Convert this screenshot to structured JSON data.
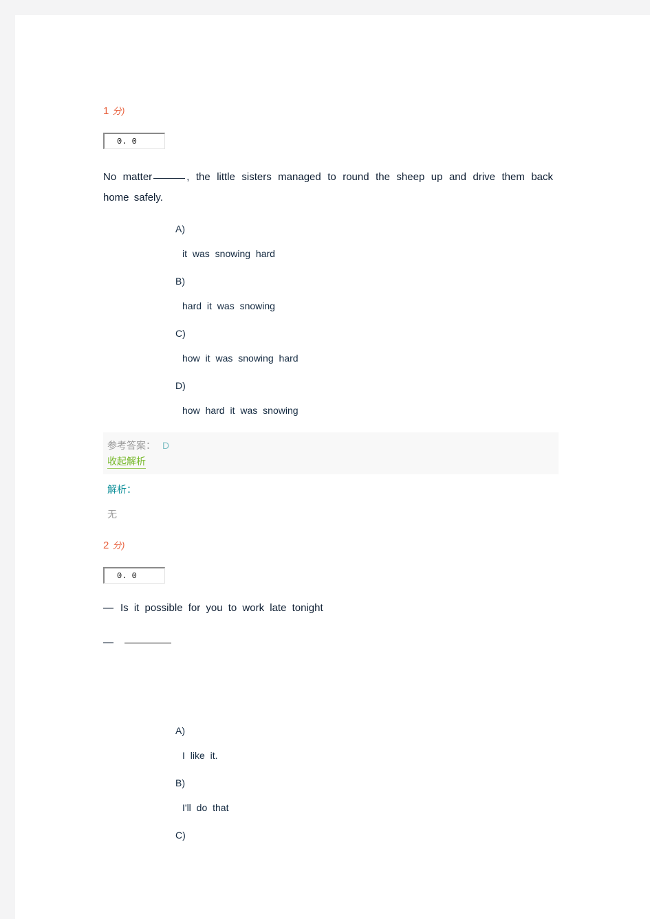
{
  "page": {
    "background": "#f4f4f5",
    "sheet_background": "#ffffff"
  },
  "colors": {
    "score_header": "#e8603c",
    "body_text": "#0f1f33",
    "answer_label": "#9b9b9b",
    "answer_value": "#7fbfc4",
    "toggle_link": "#76b82a",
    "analysis_label": "#0d8f99",
    "answer_band_bg": "#f8f8f8"
  },
  "questions": [
    {
      "score_number": "1",
      "score_unit": "分)",
      "score_input_value": "0. 0",
      "score_input_placeholder": "0. 0",
      "stem_before_blank": "No  matter",
      "stem_after_blank": ", the  little  sisters  managed  to  round  the  sheep  up  and  drive  them  back  home  safely.",
      "options": [
        {
          "letter": "A)",
          "text": "it  was  snowing  hard"
        },
        {
          "letter": "B)",
          "text": "hard  it  was  snowing"
        },
        {
          "letter": "C)",
          "text": "how  it  was  snowing  hard"
        },
        {
          "letter": "D)",
          "text": "how  hard  it  was  snowing"
        }
      ],
      "answer_label": "参考答案：",
      "answer_value": "D",
      "toggle_label": "收起解析",
      "analysis_label": "解析：",
      "analysis_body": "无"
    },
    {
      "score_number": "2",
      "score_unit": "分)",
      "score_input_value": "0. 0",
      "score_input_placeholder": "0. 0",
      "dialog_dash": "—",
      "dialog_question": "Is  it  possible  for  you  to  work  late  tonight",
      "dialog_answer_dash": "—",
      "options": [
        {
          "letter": "A)",
          "text": "I  like  it."
        },
        {
          "letter": "B)",
          "text": "I'll  do  that"
        },
        {
          "letter": "C)",
          "text": ""
        }
      ]
    }
  ]
}
